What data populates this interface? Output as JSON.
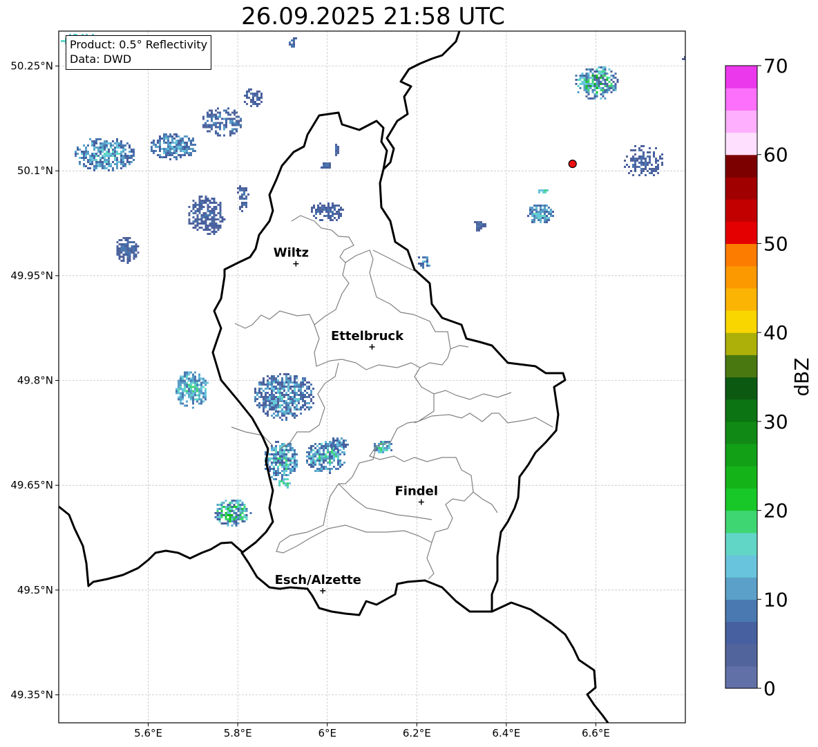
{
  "title": "26.09.2025 21:58 UTC",
  "info": {
    "product": "Product: 0.5° Reflectivity",
    "data": "Data: DWD"
  },
  "map": {
    "lon_range": [
      5.4,
      6.8
    ],
    "lat_range": [
      49.31,
      50.3
    ],
    "lon_ticks": [
      {
        "value": 5.6,
        "label": "5.6°E"
      },
      {
        "value": 5.8,
        "label": "5.8°E"
      },
      {
        "value": 6.0,
        "label": "6°E"
      },
      {
        "value": 6.2,
        "label": "6.2°E"
      },
      {
        "value": 6.4,
        "label": "6.4°E"
      },
      {
        "value": 6.6,
        "label": "6.6°E"
      }
    ],
    "lat_ticks": [
      {
        "value": 50.25,
        "label": "50.25°N"
      },
      {
        "value": 50.1,
        "label": "50.1°N"
      },
      {
        "value": 49.95,
        "label": "49.95°N"
      },
      {
        "value": 49.8,
        "label": "49.8°N"
      },
      {
        "value": 49.65,
        "label": "49.65°N"
      },
      {
        "value": 49.5,
        "label": "49.5°N"
      },
      {
        "value": 49.35,
        "label": "49.35°N"
      }
    ],
    "cities": [
      {
        "name": "Wiltz",
        "lon": 5.93,
        "lat": 49.967
      },
      {
        "name": "Ettelbruck",
        "lon": 6.1,
        "lat": 49.848
      },
      {
        "name": "Findel",
        "lon": 6.21,
        "lat": 49.626
      },
      {
        "name": "Esch/Alzette",
        "lon": 5.99,
        "lat": 49.499
      }
    ],
    "radar_site": {
      "lon": 6.548,
      "lat": 50.11,
      "color": "#ee1111"
    }
  },
  "colorbar": {
    "label": "dBZ",
    "min": 0,
    "max": 70,
    "ticks": [
      "0",
      "10",
      "20",
      "30",
      "40",
      "50",
      "60",
      "70"
    ],
    "colors": [
      "#6270a8",
      "#52649c",
      "#4660a0",
      "#4a78b0",
      "#5aa0c8",
      "#68c4dc",
      "#62d6c6",
      "#3ed672",
      "#18c828",
      "#14b418",
      "#12a016",
      "#108a14",
      "#0c7412",
      "#0c5a12",
      "#4a7810",
      "#acb008",
      "#fad600",
      "#fcb404",
      "#fc9800",
      "#fc7c00",
      "#e40000",
      "#c20000",
      "#a00000",
      "#7c0000",
      "#fee0fe",
      "#feb0fe",
      "#fc70fc",
      "#ec38ec"
    ]
  }
}
